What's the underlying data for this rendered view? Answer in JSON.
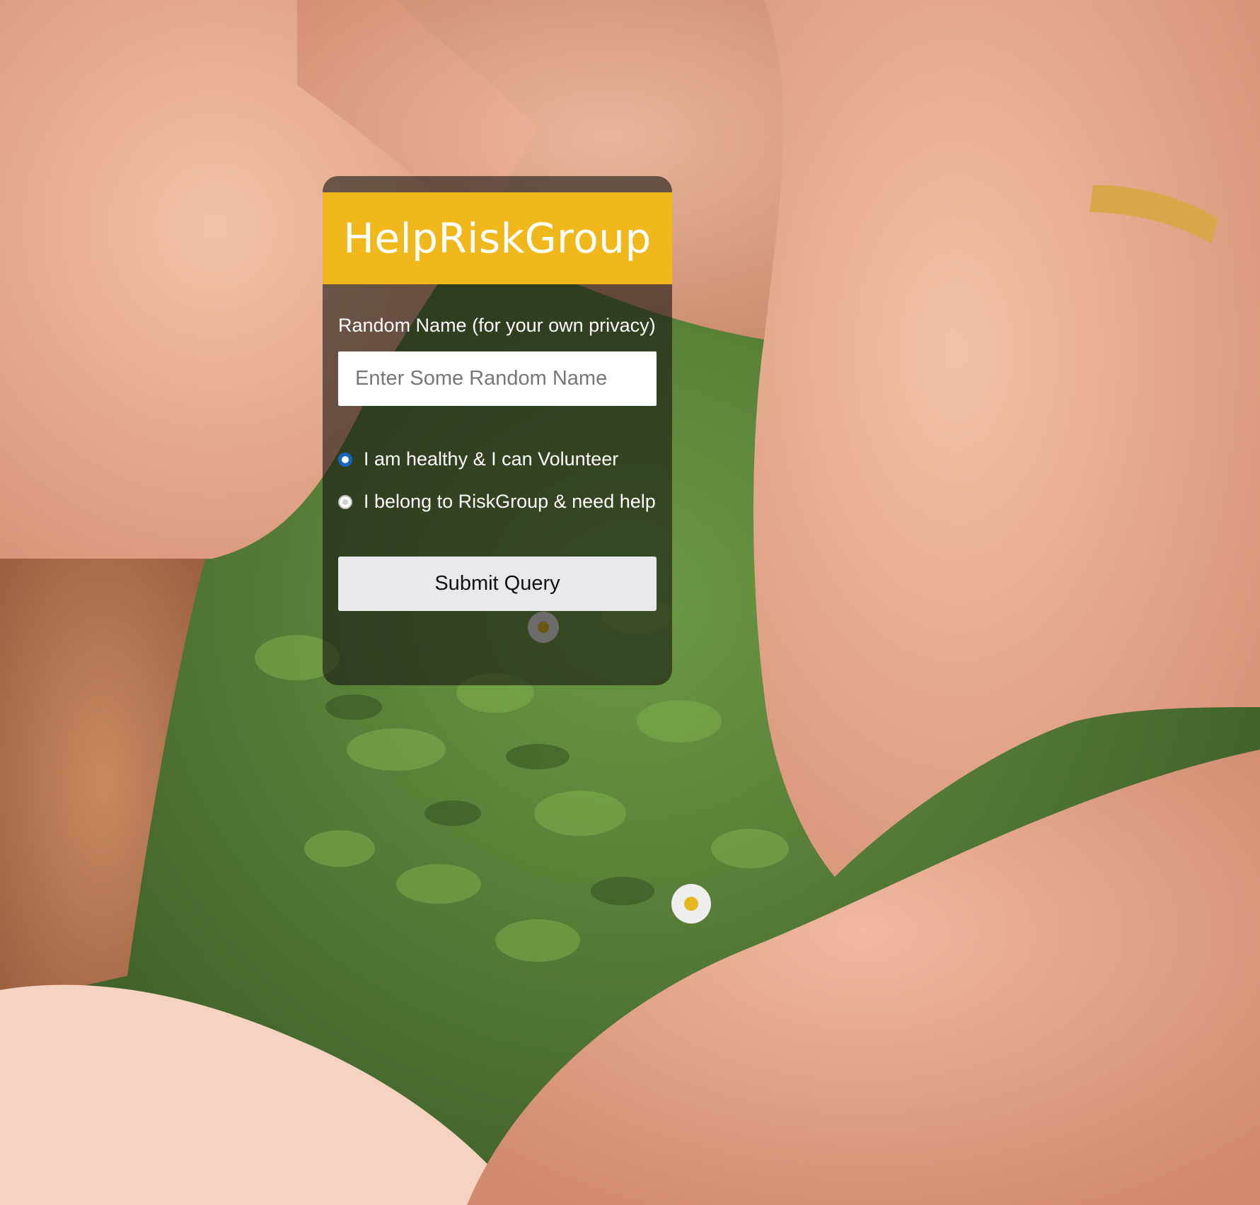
{
  "app": {
    "title": "HelpRiskGroup"
  },
  "form": {
    "name_label": "Random Name (for your own privacy)",
    "name_placeholder": "Enter Some Random Name",
    "name_value": "",
    "options": [
      {
        "label": "I am healthy & I can Volunteer",
        "selected": true
      },
      {
        "label": "I belong to RiskGroup & need help",
        "selected": false
      }
    ],
    "submit_label": "Submit Query"
  },
  "colors": {
    "header_bg": "#f1b81b",
    "card_bg": "rgba(22,20,16,0.60)",
    "radio_accent": "#1565c0",
    "button_bg": "#e8e8ed"
  },
  "background": {
    "description_icon": "hands-on-grass-photo"
  }
}
